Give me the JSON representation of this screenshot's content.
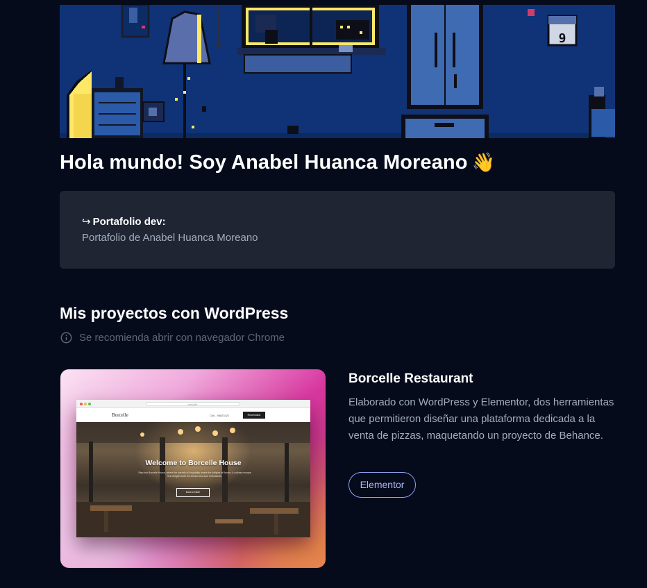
{
  "colors": {
    "background": "#060b1c",
    "card": "#1f2533",
    "hero_blue": "#0f3376",
    "accent": "#8da2ef",
    "pixel_yellow": "#ffe867"
  },
  "hero": {
    "calendar_day": "9"
  },
  "headline": {
    "text": "Hola mundo! Soy Anabel Huanca Moreano",
    "emoji": "👋"
  },
  "info_card": {
    "arrow_icon": "↪",
    "title": "Portafolio dev:",
    "description": "Portafolio de Anabel Huanca Moreano"
  },
  "projects_section": {
    "title": "Mis proyectos con WordPress",
    "note_icon": "info-icon",
    "note": "Se recomienda abrir con navegador Chrome"
  },
  "projects": [
    {
      "title": "Borcelle Restaurant",
      "description": "Elaborado con WordPress y Elementor, dos herramientas que permitieron diseñar una plataforma dedicada a la venta de pizzas, maquetando un proyecto de Behance.",
      "tag": "Elementor",
      "screenshot": {
        "url_text": "borcelle",
        "logo": "Borcelle",
        "phone": "Call - 98823422",
        "cta": "Reservation",
        "welcome": "Welcome to Borcelle House",
        "subtitle": "Step into Borcelle House, where the warmth of hospitality meets the delights of flavors. A culinary escape that delights both the senses and soul enthusiasts.",
        "button": "Book a Table"
      }
    }
  ]
}
